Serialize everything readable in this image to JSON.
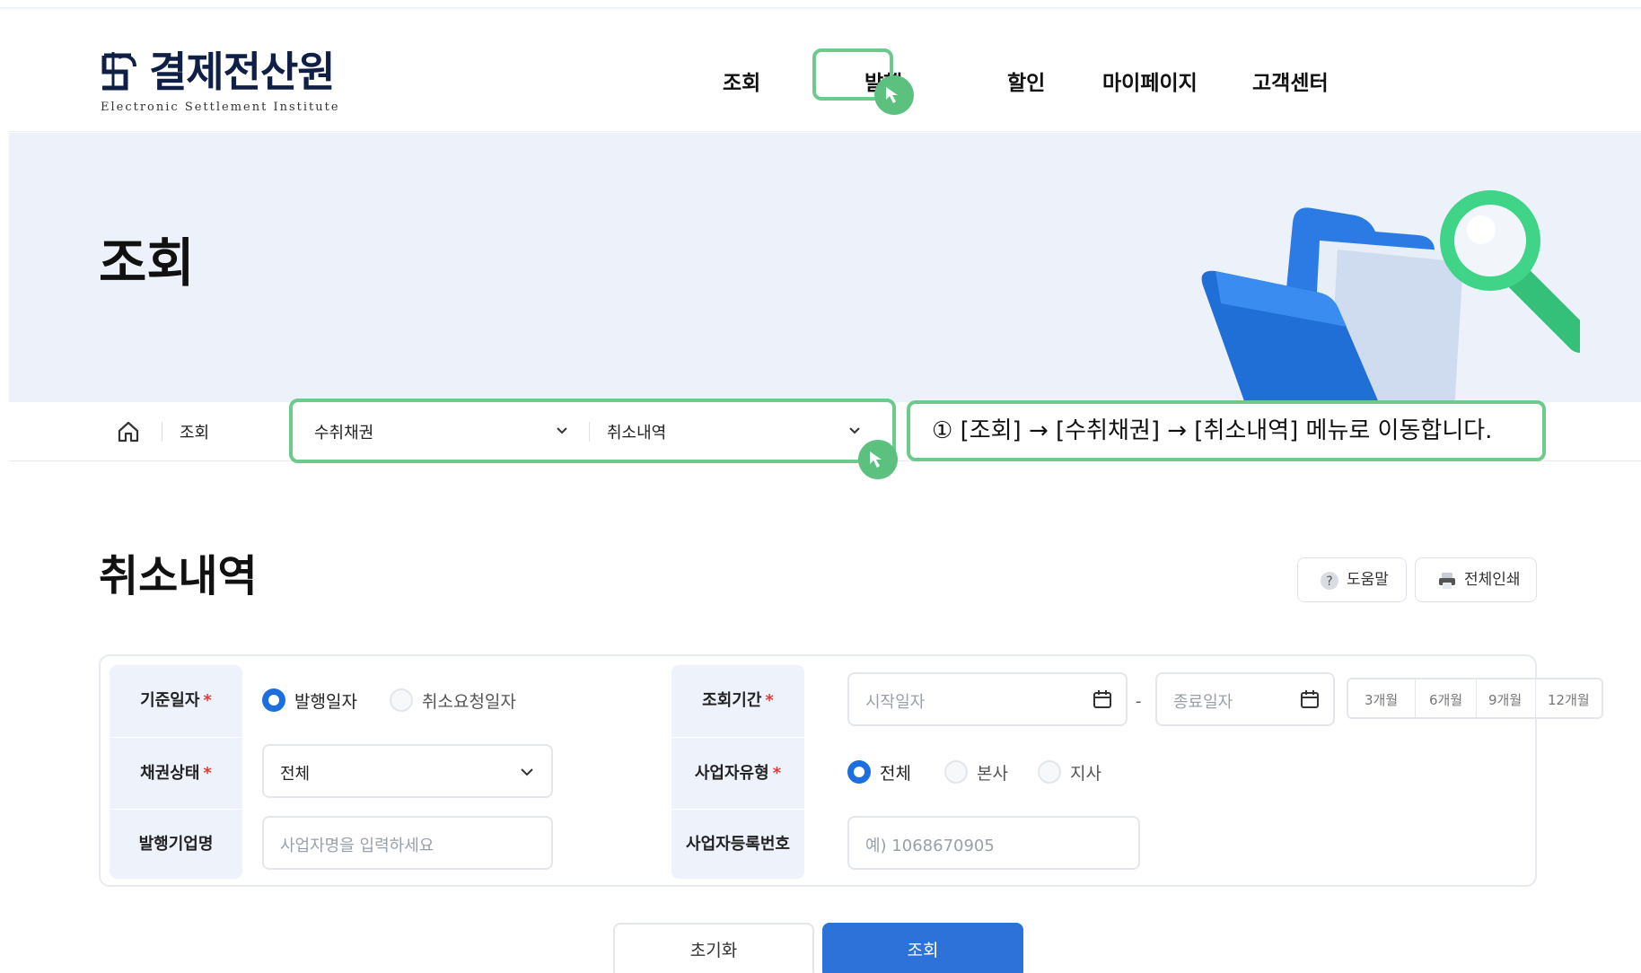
{
  "header": {
    "logo_name": "결제전산원",
    "logo_sub": "Electronic Settlement Institute",
    "nav": [
      "조회",
      "발행",
      "할인",
      "마이페이지",
      "고객센터"
    ]
  },
  "banner": {
    "title": "조회"
  },
  "breadcrumb": {
    "home": "조회",
    "dropdown1": "수취채권",
    "dropdown2": "취소내역"
  },
  "callout": "① [조회] → [수취채권] → [취소내역] 메뉴로 이동합니다.",
  "page": {
    "title": "취소내역",
    "help_label": "도움말",
    "print_label": "전체인쇄"
  },
  "form": {
    "base_date_label": "기준일자",
    "base_date_options": [
      "발행일자",
      "취소요청일자"
    ],
    "period_label": "조회기간",
    "start_placeholder": "시작일자",
    "end_placeholder": "종료일자",
    "dash": "-",
    "period_buttons": [
      "3개월",
      "6개월",
      "9개월",
      "12개월"
    ],
    "status_label": "채권상태",
    "status_value": "전체",
    "biz_type_label": "사업자유형",
    "biz_type_options": [
      "전체",
      "본사",
      "지사"
    ],
    "company_label": "발행기업명",
    "company_placeholder": "사업자명을 입력하세요",
    "reg_no_label": "사업자등록번호",
    "reg_no_placeholder": "예) 1068670905",
    "required_mark": "*"
  },
  "buttons": {
    "reset": "초기화",
    "search": "조회"
  },
  "colors": {
    "accent": "#2d72d9",
    "highlight": "#6ccb8b",
    "banner_bg": "#edf2fa",
    "required": "#e53935"
  }
}
